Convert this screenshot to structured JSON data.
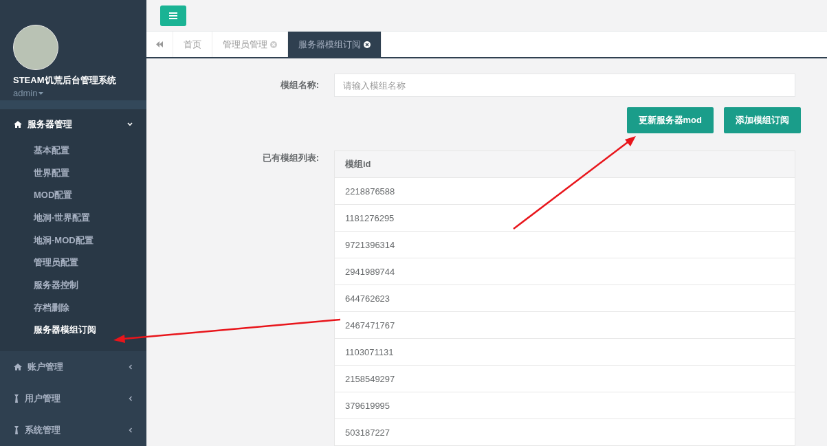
{
  "sidebar": {
    "profile": {
      "name": "STEAM饥荒后台管理系统",
      "role": "admin"
    },
    "menu": [
      {
        "label": "服务器管理",
        "expanded": true,
        "children": [
          {
            "label": "基本配置",
            "selected": false
          },
          {
            "label": "世界配置",
            "selected": false
          },
          {
            "label": "MOD配置",
            "selected": false
          },
          {
            "label": "地洞-世界配置",
            "selected": false
          },
          {
            "label": "地洞-MOD配置",
            "selected": false
          },
          {
            "label": "管理员配置",
            "selected": false
          },
          {
            "label": "服务器控制",
            "selected": false
          },
          {
            "label": "存档删除",
            "selected": false
          },
          {
            "label": "服务器模组订阅",
            "selected": true
          }
        ]
      },
      {
        "label": "账户管理",
        "expanded": false
      },
      {
        "label": "用户管理",
        "expanded": false
      },
      {
        "label": "系统管理",
        "expanded": false
      }
    ]
  },
  "tabs": [
    {
      "label": "首页",
      "closable": false,
      "selected": false
    },
    {
      "label": "管理员管理",
      "closable": true,
      "selected": false
    },
    {
      "label": "服务器模组订阅",
      "closable": true,
      "selected": true
    }
  ],
  "form": {
    "name_label": "模组名称:",
    "name_placeholder": "请输入模组名称",
    "buttons": [
      "更新服务器mod",
      "添加模组订阅"
    ],
    "list_label": "已有模组列表:"
  },
  "table": {
    "columns": [
      "模组id"
    ],
    "rows": [
      [
        "2218876588"
      ],
      [
        "1181276295"
      ],
      [
        "9721396314"
      ],
      [
        "2941989744"
      ],
      [
        "644762623"
      ],
      [
        "2467471767"
      ],
      [
        "1103071131"
      ],
      [
        "2158549297"
      ],
      [
        "379619995"
      ],
      [
        "503187227"
      ]
    ]
  }
}
